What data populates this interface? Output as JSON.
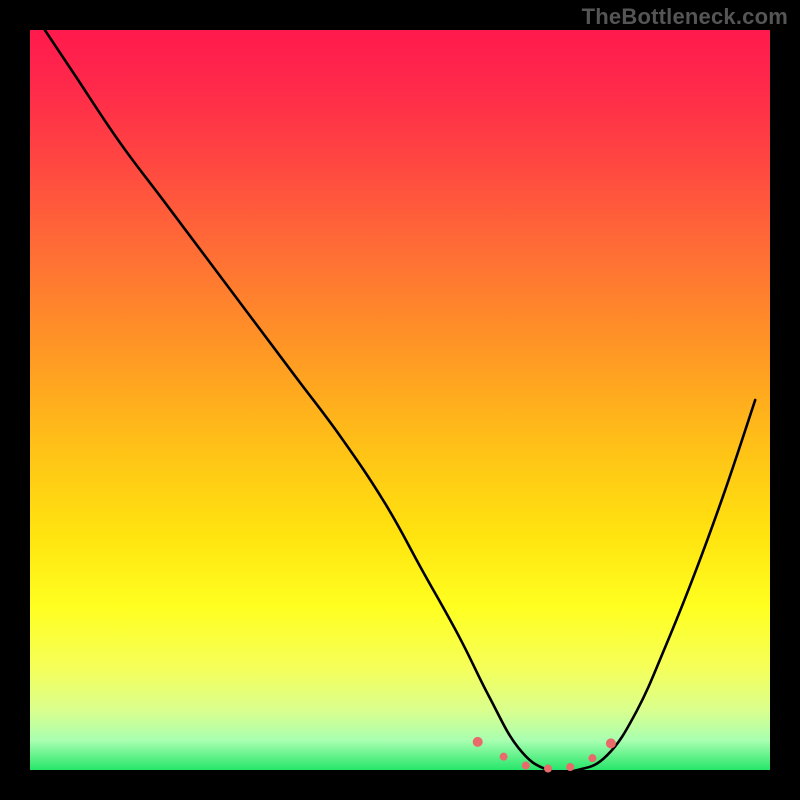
{
  "watermark": "TheBottleneck.com",
  "plot": {
    "inner_x": 30,
    "inner_y": 30,
    "inner_w": 740,
    "inner_h": 740
  },
  "gradient_stops": [
    {
      "offset": 0.0,
      "color": "#ff1a4d"
    },
    {
      "offset": 0.08,
      "color": "#ff2a4a"
    },
    {
      "offset": 0.18,
      "color": "#ff4741"
    },
    {
      "offset": 0.3,
      "color": "#ff6e35"
    },
    {
      "offset": 0.42,
      "color": "#ff9326"
    },
    {
      "offset": 0.55,
      "color": "#ffbd18"
    },
    {
      "offset": 0.68,
      "color": "#ffe30f"
    },
    {
      "offset": 0.78,
      "color": "#ffff20"
    },
    {
      "offset": 0.86,
      "color": "#f6ff58"
    },
    {
      "offset": 0.92,
      "color": "#d9ff8e"
    },
    {
      "offset": 0.96,
      "color": "#a8ffb0"
    },
    {
      "offset": 1.0,
      "color": "#26e66a"
    }
  ],
  "chart_data": {
    "type": "line",
    "title": "",
    "xlabel": "",
    "ylabel": "",
    "xlim": [
      0,
      100
    ],
    "ylim": [
      0,
      100
    ],
    "grid": false,
    "series": [
      {
        "name": "bottleneck-curve",
        "x": [
          2,
          6,
          12,
          18,
          24,
          30,
          36,
          42,
          48,
          53,
          58,
          62,
          66,
          70,
          74,
          78,
          82,
          86,
          90,
          94,
          98
        ],
        "values": [
          100,
          94,
          85,
          77,
          69,
          61,
          53,
          45,
          36,
          27,
          18,
          10,
          3,
          0,
          0,
          2,
          8,
          17,
          27,
          38,
          50
        ]
      }
    ],
    "markers": {
      "name": "optimal-band",
      "x": [
        60.5,
        64,
        67,
        70,
        73,
        76,
        78.5
      ],
      "values": [
        3.8,
        1.8,
        0.6,
        0.2,
        0.4,
        1.6,
        3.6
      ],
      "radius": [
        5,
        4,
        4,
        4,
        4,
        4,
        5
      ],
      "color": "#e86a6a"
    }
  }
}
